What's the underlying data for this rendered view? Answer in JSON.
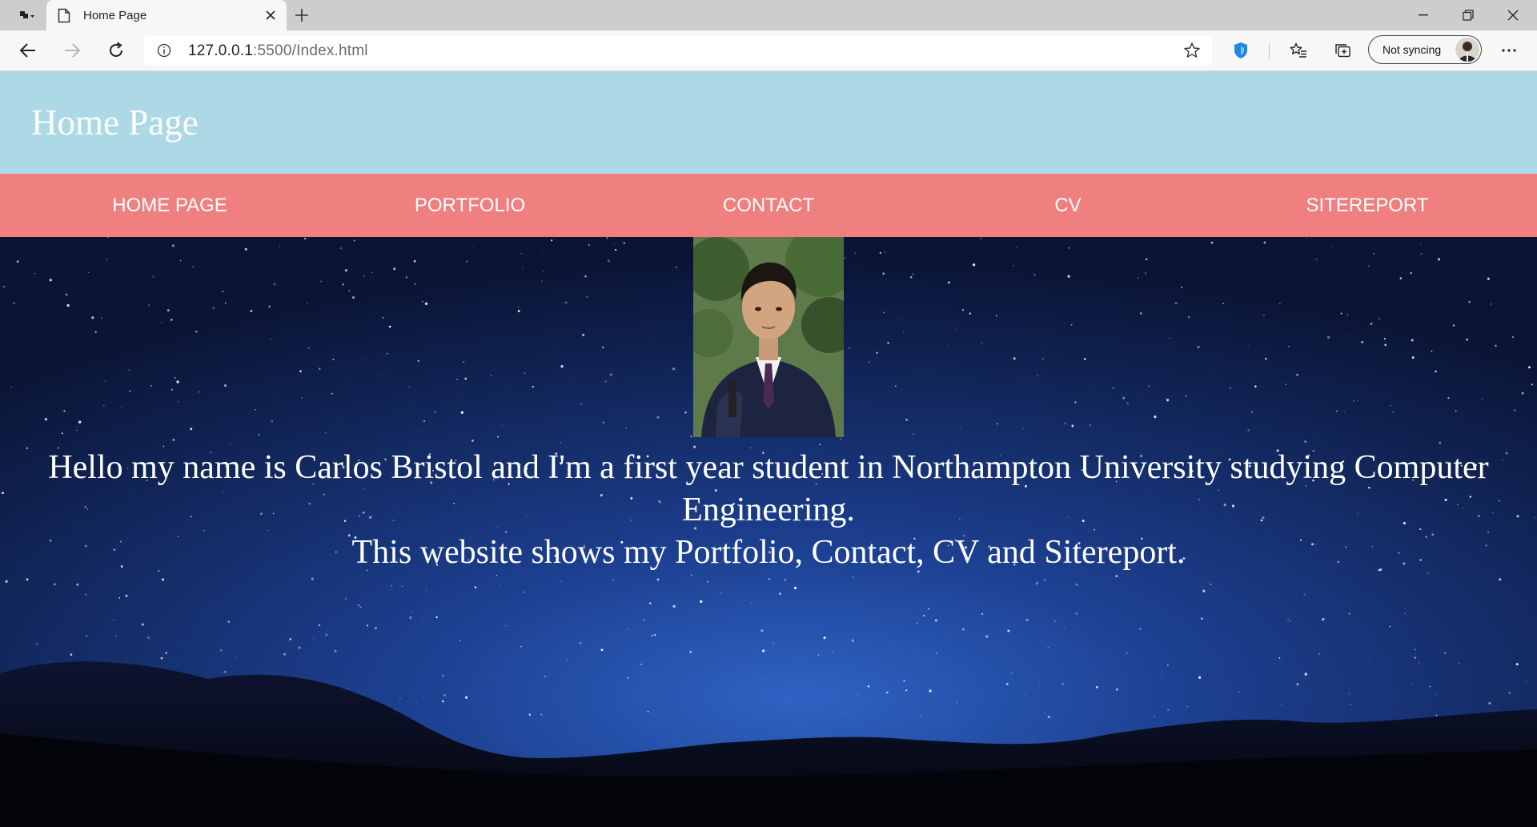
{
  "browser": {
    "tab_title": "Home Page",
    "url_host": "127.0.0.1",
    "url_rest": ":5500/Index.html",
    "profile_label": "Not syncing"
  },
  "site": {
    "header_title": "Home Page",
    "nav": [
      {
        "label": "HOME PAGE"
      },
      {
        "label": "PORTFOLIO"
      },
      {
        "label": "CONTACT"
      },
      {
        "label": "CV"
      },
      {
        "label": "SITEREPORT"
      }
    ],
    "intro_line1": "Hello my name is Carlos Bristol and I'm a first year student in Northampton University studying Computer Engineering.",
    "intro_line2": "This website shows my Portfolio, Contact, CV and Sitereport."
  },
  "colors": {
    "header_bg": "#add8e6",
    "nav_bg": "#f08080",
    "text": "#ffffff"
  }
}
